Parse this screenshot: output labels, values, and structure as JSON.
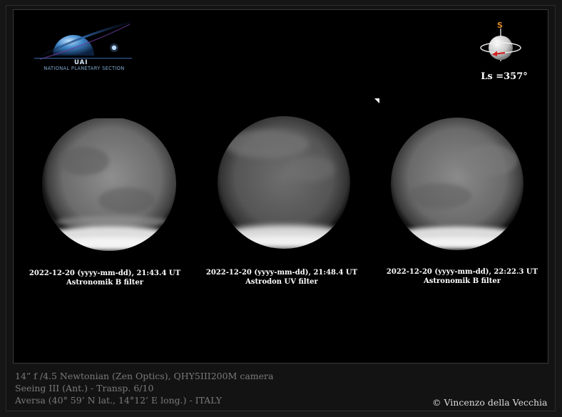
{
  "logo": {
    "acronym": "UAI",
    "section_name": "NATIONAL PLANETARY SECTION"
  },
  "orientation": {
    "south_label": "S",
    "ls_label": "Ls =357°"
  },
  "observations": [
    {
      "timestamp": "2022-12-20 (yyyy-mm-dd), 21:43.4 UT",
      "filter": "Astronomik B filter"
    },
    {
      "timestamp": "2022-12-20 (yyyy-mm-dd), 21:48.4 UT",
      "filter": "Astrodon UV filter"
    },
    {
      "timestamp": "2022-12-20 (yyyy-mm-dd), 22:22.3 UT",
      "filter": "Astronomik B filter"
    }
  ],
  "footer": {
    "telescope": "14” f /4.5 Newtonian (Zen Optics), QHY5III200M camera",
    "seeing": "Seeing  III (Ant.) - Transp. 6/10",
    "location": "Aversa (40° 59’ N lat., 14°12’ E long.) - ITALY",
    "credit": "© Vincenzo della Vecchia"
  },
  "colors": {
    "orientation_south": "#e08a2a",
    "orientation_arrow": "#d42020",
    "logo_blue": "#7fa8d0"
  }
}
